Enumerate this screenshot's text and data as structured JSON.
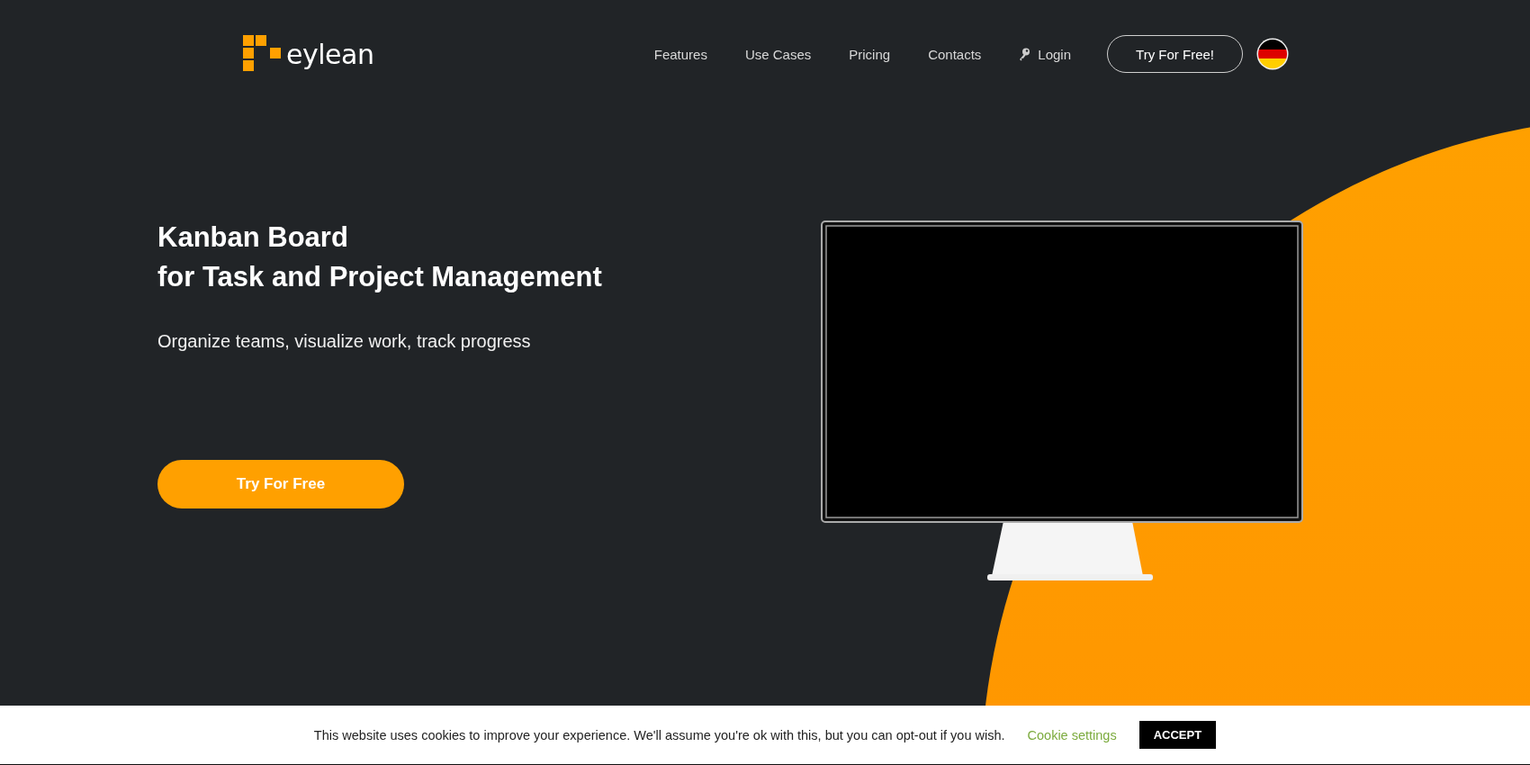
{
  "header": {
    "logo": {
      "text": "eylean"
    },
    "nav": [
      {
        "label": "Features",
        "kind": "link"
      },
      {
        "label": "Use Cases",
        "kind": "link"
      },
      {
        "label": "Pricing",
        "kind": "link"
      },
      {
        "label": "Contacts",
        "kind": "link"
      },
      {
        "label": "Login",
        "kind": "login"
      }
    ],
    "cta": "Try For Free!"
  },
  "hero": {
    "title_lines": [
      "Kanban Board",
      "for Task and Project Management"
    ],
    "subtitle": "Organize teams, visualize work, track progress",
    "cta": "Try For Free"
  },
  "cookie_bar": {
    "message": "This website uses cookies to improve your experience. We'll assume you're ok with this, but you can opt-out if you wish.",
    "settings_link": "Cookie settings",
    "accept": "ACCEPT"
  }
}
